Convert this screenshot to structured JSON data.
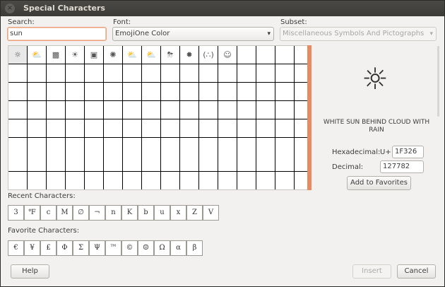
{
  "window": {
    "title": "Special Characters",
    "close_glyph": "×"
  },
  "search": {
    "label": "Search:",
    "value": "sun"
  },
  "font": {
    "label": "Font:",
    "value": "EmojiOne Color",
    "arrow": "▾"
  },
  "subset": {
    "label": "Subset:",
    "value": "Miscellaneous Symbols And Pictographs",
    "arrow": "▾"
  },
  "grid": {
    "first_row": [
      "☼",
      "⛅",
      "▩",
      "☀",
      "▣",
      "✺",
      "⛅",
      "⛅",
      "⛈",
      "✹",
      "(∴)",
      "☺",
      "",
      "",
      "",
      ""
    ]
  },
  "preview": {
    "glyph": "☼",
    "name": "WHITE SUN BEHIND CLOUD WITH RAIN",
    "hex_label": "Hexadecimal:",
    "hex_prefix": "U+",
    "hex_value": "1F326",
    "dec_label": "Decimal:",
    "dec_value": "127782",
    "add_favorites": "Add to Favorites"
  },
  "recent": {
    "label": "Recent Characters:",
    "chars": [
      "3",
      "℉",
      "ⅽ",
      "M",
      "∅",
      "¬",
      "n",
      "K",
      "b",
      "u",
      "x",
      "Z",
      "V"
    ]
  },
  "favorites": {
    "label": "Favorite Characters:",
    "chars": [
      "€",
      "¥",
      "£",
      "Φ",
      "Σ",
      "Ψ",
      "™",
      "©",
      "☺",
      "Ω",
      "α",
      "β"
    ]
  },
  "buttons": {
    "help": "Help",
    "insert": "Insert",
    "cancel": "Cancel"
  }
}
